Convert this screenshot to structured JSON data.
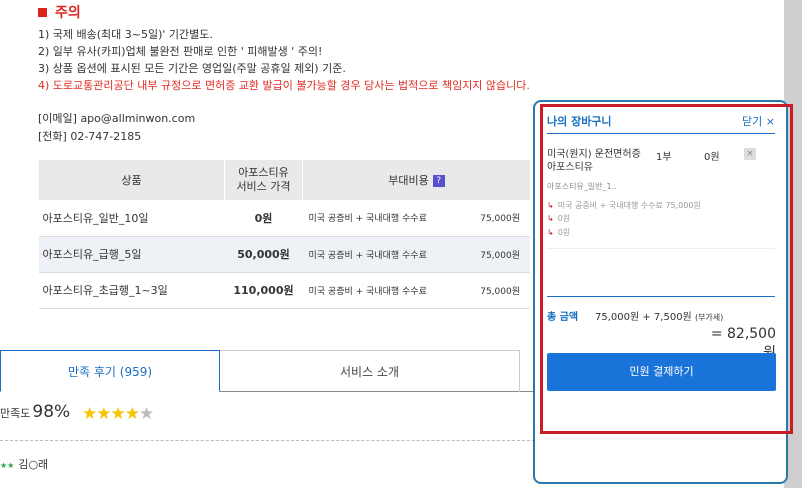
{
  "notice": {
    "title": "주의",
    "lines": [
      "1) 국제 배송(최대 3~5일)' 기간별도.",
      "2) 일부 유사(카피)업체 불완전 판매로 인한 ' 피해발생 ' 주의!",
      "3) 상품 옵션에 표시된 모든 기간은 영업일(주말 공휴일 제외) 기준.",
      "4) 도로교통관리공단 내부 규정으로 면허증 교환 발급이 불가능할 경우 당사는 법적으로 책임지지 않습니다."
    ]
  },
  "contact": {
    "email": "[이메일] apo@allminwon.com",
    "phone": "[전화] 02-747-2185"
  },
  "table": {
    "headers": [
      "상품",
      "아포스티유\n서비스 가격",
      "부대비용"
    ],
    "help": "?",
    "rows": [
      {
        "name": "아포스티유_일반_10일",
        "price": "0원",
        "extra": "미국 공증비 + 국내대행 수수료",
        "amount": "75,000원"
      },
      {
        "name": "아포스티유_급행_5일",
        "price": "50,000원",
        "extra": "미국 공증비 + 국내대행 수수료",
        "amount": "75,000원"
      },
      {
        "name": "아포스티유_초급행_1~3일",
        "price": "110,000원",
        "extra": "미국 공증비 + 국내대행 수수료",
        "amount": "75,000원"
      }
    ]
  },
  "tabs": [
    {
      "label": "만족 후기 (959)"
    },
    {
      "label": "서비스 소개"
    }
  ],
  "satisfaction": {
    "label": "만족도",
    "percent": "98%",
    "rating": 4.5
  },
  "review": {
    "name": "김○래"
  },
  "cart": {
    "title": "나의 장바구니",
    "close": "닫기 ×",
    "item": {
      "name": "미국(원지) 운전면허증 아포스티유",
      "qty": "1부",
      "price": "0원",
      "delete": "×",
      "option": "아포스티유_일반_1..",
      "sub1": "미국 공증비 + 국내대행 수수료 75,000원",
      "sub2": "0원",
      "sub3": "0원"
    },
    "total_label": "총 금액",
    "total_calc": "75,000원 + 7,500원",
    "vat": "(부가세)",
    "total_sum": "= 82,500원",
    "pay_button": "민원 결제하기"
  },
  "colors": {
    "accent": "#1a73d9",
    "alert": "#e02b20",
    "cart_border": "#2a78a8",
    "highlight": "#c81d25"
  }
}
